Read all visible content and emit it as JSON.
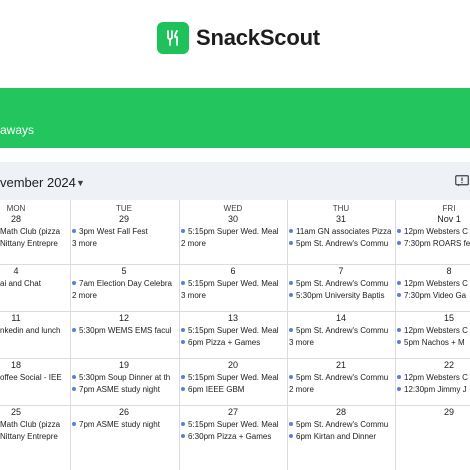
{
  "app": {
    "name": "SnackScout",
    "brand_color": "#22c55e",
    "logo_icon": "fork-icon"
  },
  "banner": {
    "text": "aways"
  },
  "calendar": {
    "month_label": "vember 2024",
    "caret_icon": "caret-down-icon",
    "feedback_icon": "feedback-icon",
    "dot_color": "#5b7fd6",
    "days_of_week": [
      "MON",
      "TUE",
      "WED",
      "THU",
      "FRI"
    ],
    "weeks": [
      {
        "days": [
          {
            "num": "28",
            "events": [
              "Math Club (pizza",
              "Nittany Entrepre"
            ],
            "more": ""
          },
          {
            "num": "29",
            "events": [
              "3pm West Fall Fest"
            ],
            "more": "3 more"
          },
          {
            "num": "30",
            "events": [
              "5:15pm Super Wed. Meal"
            ],
            "more": "2 more"
          },
          {
            "num": "31",
            "events": [
              "11am GN associates Pizza",
              "5pm St. Andrew's Commu"
            ],
            "more": ""
          },
          {
            "num": "Nov 1",
            "events": [
              "12pm Websters C",
              "7:30pm ROARS fe"
            ],
            "more": ""
          }
        ]
      },
      {
        "days": [
          {
            "num": "4",
            "events": [
              "ai and Chat"
            ],
            "more": ""
          },
          {
            "num": "5",
            "events": [
              "7am Election Day Celebra"
            ],
            "more": "2 more"
          },
          {
            "num": "6",
            "events": [
              "5:15pm Super Wed. Meal"
            ],
            "more": "3 more"
          },
          {
            "num": "7",
            "events": [
              "5pm St. Andrew's Commu",
              "5:30pm University Baptis"
            ],
            "more": ""
          },
          {
            "num": "8",
            "events": [
              "12pm Websters C",
              "7:30pm Video Ga"
            ],
            "more": ""
          }
        ]
      },
      {
        "days": [
          {
            "num": "11",
            "events": [
              "nkedin and lunch"
            ],
            "more": ""
          },
          {
            "num": "12",
            "events": [
              "5:30pm WEMS EMS facul"
            ],
            "more": ""
          },
          {
            "num": "13",
            "events": [
              "5:15pm Super Wed. Meal",
              "6pm Pizza + Games"
            ],
            "more": ""
          },
          {
            "num": "14",
            "events": [
              "5pm St. Andrew's Commu"
            ],
            "more": "3 more"
          },
          {
            "num": "15",
            "events": [
              "12pm Websters C",
              "5pm Nachos + M"
            ],
            "more": ""
          }
        ]
      },
      {
        "days": [
          {
            "num": "18",
            "events": [
              "offee Social - IEE"
            ],
            "more": ""
          },
          {
            "num": "19",
            "events": [
              "5:30pm Soup Dinner at th",
              "7pm ASME study night"
            ],
            "more": ""
          },
          {
            "num": "20",
            "events": [
              "5:15pm Super Wed. Meal",
              "6pm IEEE GBM"
            ],
            "more": ""
          },
          {
            "num": "21",
            "events": [
              "5pm St. Andrew's Commu"
            ],
            "more": "2 more"
          },
          {
            "num": "22",
            "events": [
              "12pm Websters C",
              "12:30pm Jimmy J"
            ],
            "more": ""
          }
        ]
      },
      {
        "days": [
          {
            "num": "25",
            "events": [
              "Math Club (pizza",
              "Nittany Entrepre"
            ],
            "more": ""
          },
          {
            "num": "26",
            "events": [
              "7pm ASME study night"
            ],
            "more": ""
          },
          {
            "num": "27",
            "events": [
              "5:15pm Super Wed. Meal",
              "6:30pm Pizza + Games"
            ],
            "more": ""
          },
          {
            "num": "28",
            "events": [
              "5pm St. Andrew's Commu",
              "6pm Kirtan and Dinner"
            ],
            "more": ""
          },
          {
            "num": "29",
            "events": [],
            "more": ""
          }
        ]
      }
    ]
  }
}
